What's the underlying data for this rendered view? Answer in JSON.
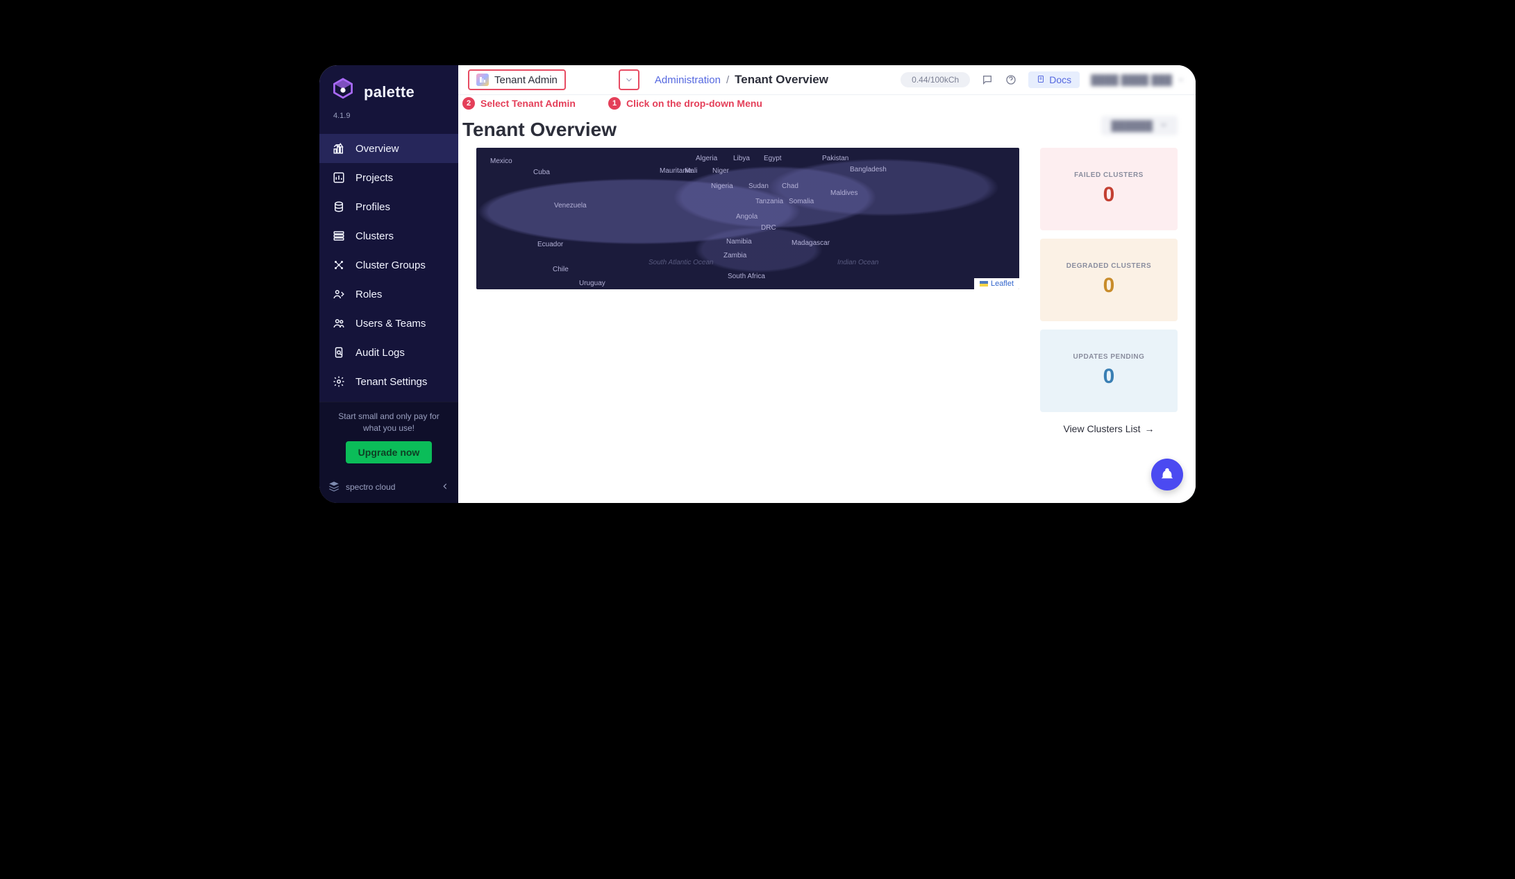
{
  "app": {
    "name": "palette",
    "version": "4.1.9"
  },
  "sidebar": {
    "items": [
      {
        "label": "Overview",
        "icon": "overview-icon",
        "active": true
      },
      {
        "label": "Projects",
        "icon": "projects-icon"
      },
      {
        "label": "Profiles",
        "icon": "profiles-icon"
      },
      {
        "label": "Clusters",
        "icon": "clusters-icon"
      },
      {
        "label": "Cluster Groups",
        "icon": "cluster-groups-icon"
      },
      {
        "label": "Roles",
        "icon": "roles-icon"
      },
      {
        "label": "Users & Teams",
        "icon": "users-teams-icon"
      },
      {
        "label": "Audit Logs",
        "icon": "audit-logs-icon"
      },
      {
        "label": "Tenant Settings",
        "icon": "tenant-settings-icon"
      }
    ],
    "upgrade": {
      "text": "Start small and only pay for what you use!",
      "button": "Upgrade now"
    },
    "footer_brand": "spectro cloud"
  },
  "header": {
    "scope_label": "Tenant Admin",
    "breadcrumb": {
      "root": "Administration",
      "leaf": "Tenant Overview"
    },
    "credits": "0.44/100kCh",
    "docs_label": "Docs",
    "user_name": "████ ████ ███"
  },
  "annotations": {
    "step1": {
      "num": "1",
      "text": "Click on the drop-down Menu"
    },
    "step2": {
      "num": "2",
      "text": "Select Tenant Admin"
    }
  },
  "page": {
    "title": "Tenant Overview",
    "period_selected": "██████"
  },
  "map": {
    "labels": [
      "Mexico",
      "Cuba",
      "Venezuela",
      "Ecuador",
      "Chile",
      "Uruguay",
      "Algeria",
      "Libya",
      "Egypt",
      "Mauritania",
      "Mali",
      "Niger",
      "Nigeria",
      "Sudan",
      "Chad",
      "Tanzania",
      "Somalia",
      "Angola",
      "DRC",
      "Namibia",
      "Zambia",
      "Madagascar",
      "South Africa",
      "Pakistan",
      "Bangladesh",
      "Maldives"
    ],
    "oceans": [
      "South Atlantic Ocean",
      "Indian Ocean"
    ],
    "attribution": "Leaflet"
  },
  "stats": {
    "failed": {
      "label": "FAILED CLUSTERS",
      "value": "0"
    },
    "degraded": {
      "label": "DEGRADED CLUSTERS",
      "value": "0"
    },
    "pending": {
      "label": "UPDATES PENDING",
      "value": "0"
    },
    "view_link": "View Clusters List"
  }
}
